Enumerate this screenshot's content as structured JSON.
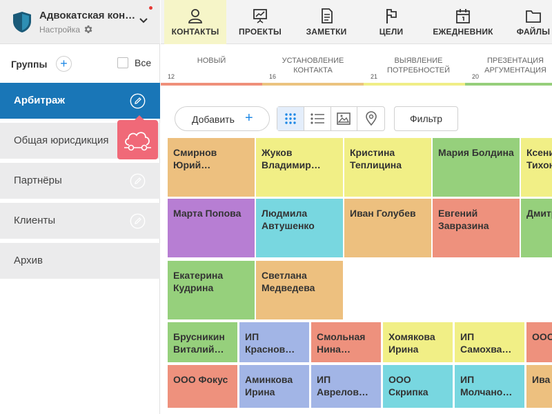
{
  "company": {
    "name": "Адвокатская кон…",
    "settings_label": "Настройка",
    "colors": {
      "header_bg": "#eeeeee",
      "logo": "#1a5a78",
      "notification_dot": "#e53935"
    }
  },
  "groups": {
    "title": "Группы",
    "all_label": "Все",
    "items": [
      {
        "label": "Арбитраж",
        "active": true
      },
      {
        "label": "Общая юрисдикция",
        "active": false
      },
      {
        "label": "Партнёры",
        "active": false
      },
      {
        "label": "Клиенты",
        "active": false
      },
      {
        "label": "Архив",
        "active": false
      }
    ],
    "active_color": "#1976b7",
    "popup_color": "#f06978"
  },
  "nav": {
    "items": [
      {
        "label": "КОНТАКТЫ",
        "icon": "person-icon",
        "active": true
      },
      {
        "label": "ПРОЕКТЫ",
        "icon": "presentation-icon",
        "active": false
      },
      {
        "label": "ЗАМЕТКИ",
        "icon": "notes-icon",
        "active": false
      },
      {
        "label": "ЦЕЛИ",
        "icon": "flag-icon",
        "active": false
      },
      {
        "label": "ЕЖЕДНЕВНИК",
        "icon": "calendar-icon",
        "active": false
      },
      {
        "label": "ФАЙЛЫ",
        "icon": "folder-icon",
        "active": false
      }
    ]
  },
  "stages": [
    {
      "name": "НОВЫЙ",
      "count": "12",
      "color": "#ef8f7a"
    },
    {
      "name": "УСТАНОВЛЕНИЕ КОНТАКТА",
      "count": "16",
      "color": "#ebc37f"
    },
    {
      "name": "ВЫЯВЛЕНИЕ ПОТРЕБНОСТЕЙ",
      "count": "21",
      "color": "#f0ee86"
    },
    {
      "name": "ПРЕЗЕНТАЦИЯ АРГУМЕНТАЦИЯ",
      "count": "20",
      "color": "#96cf7b"
    }
  ],
  "toolbar": {
    "add_label": "Добавить",
    "add_plus": "+",
    "filter_label": "Фильтр",
    "views": [
      "grid-icon",
      "list-icon",
      "image-icon",
      "map-pin-icon"
    ],
    "active_view": "grid-icon"
  },
  "cards": {
    "row1": [
      {
        "name": "Смирнов Юрий…",
        "color": "orange"
      },
      {
        "name": "Жуков Владимир…",
        "color": "yellow"
      },
      {
        "name": "Кристина Теплицина",
        "color": "yellow"
      },
      {
        "name": "Мария Болдина",
        "color": "green"
      },
      {
        "name": "Ксения Тихонова",
        "color": "yellow"
      }
    ],
    "row2": [
      {
        "name": "Марта Попова",
        "color": "purple"
      },
      {
        "name": "Людмила Автушенко",
        "color": "cyan"
      },
      {
        "name": "Иван Голубев",
        "color": "orange"
      },
      {
        "name": "Евгений Завразина",
        "color": "salmon"
      },
      {
        "name": "Дмитрий Шпак",
        "color": "green"
      }
    ],
    "row3": [
      {
        "name": "Екатерина Кудрина",
        "color": "green"
      },
      {
        "name": "Светлана Медведева",
        "color": "orange"
      }
    ],
    "row4": [
      {
        "name": "Брусникин Виталий…",
        "color": "green"
      },
      {
        "name": "ИП Краснов…",
        "color": "blue"
      },
      {
        "name": "Смольная Нина…",
        "color": "salmon"
      },
      {
        "name": "Хомякова Ирина",
        "color": "yellow"
      },
      {
        "name": "ИП Самохва…",
        "color": "yellow"
      },
      {
        "name": "ООО Пра",
        "color": "salmon"
      }
    ],
    "row5": [
      {
        "name": "ООО Фокус",
        "color": "salmon"
      },
      {
        "name": "Аминкова Ирина",
        "color": "blue"
      },
      {
        "name": "ИП Аврелов…",
        "color": "blue"
      },
      {
        "name": "ООО Скрипка",
        "color": "cyan"
      },
      {
        "name": "ИП Молчано…",
        "color": "cyan"
      },
      {
        "name": "Ива а Ве",
        "color": "orange"
      }
    ]
  }
}
